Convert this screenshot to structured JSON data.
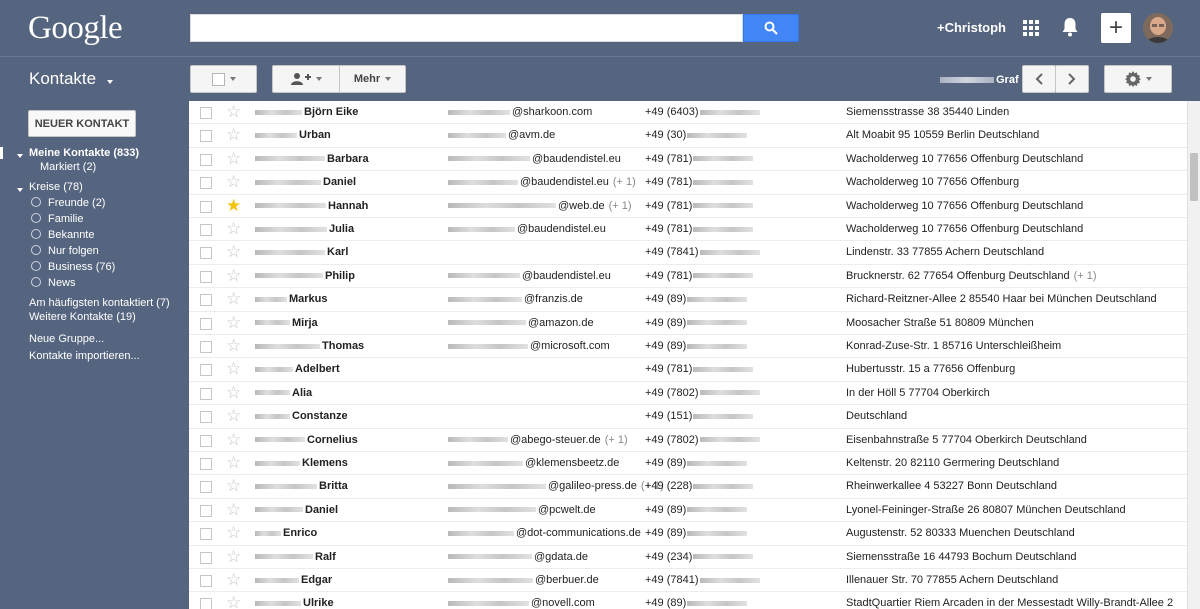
{
  "header": {
    "logo": "Google",
    "user": "+Christoph",
    "share_symbol": "+"
  },
  "toolbar": {
    "title": "Kontakte",
    "more_label": "Mehr",
    "account": "Graf"
  },
  "sidebar": {
    "new_contact": "NEUER KONTAKT",
    "my_contacts": "Meine Kontakte (833)",
    "starred": "Markiert (2)",
    "circles": "Kreise (78)",
    "circle_items": [
      "Freunde (2)",
      "Familie",
      "Bekannte",
      "Nur folgen",
      "Business (76)",
      "News"
    ],
    "most_contacted": "Am häufigsten kontaktiert (7)",
    "other_contacts": "Weitere Kontakte (19)",
    "new_group": "Neue Gruppe...",
    "import": "Kontakte importieren..."
  },
  "contacts": [
    {
      "name": "Björn Eike",
      "email": "@sharkoon.com",
      "email_extra": "",
      "phone": "+49 (6403)",
      "address": "Siemensstrasse 38 35440 Linden",
      "address_extra": "",
      "starred": false
    },
    {
      "name": "Urban",
      "email": "@avm.de",
      "email_extra": "",
      "phone": "+49 (30)",
      "address": "Alt Moabit 95 10559 Berlin Deutschland",
      "address_extra": "",
      "starred": false
    },
    {
      "name": "Barbara",
      "email": "@baudendistel.eu",
      "email_extra": "",
      "phone": "+49 (781)",
      "address": "Wacholderweg 10 77656 Offenburg Deutschland",
      "address_extra": "",
      "starred": false
    },
    {
      "name": "Daniel",
      "email": "@baudendistel.eu",
      "email_extra": "(+ 1)",
      "phone": "+49 (781)",
      "address": "Wacholderweg 10 77656 Offenburg",
      "address_extra": "",
      "starred": false
    },
    {
      "name": "Hannah",
      "email": "@web.de",
      "email_extra": "(+ 1)",
      "phone": "+49 (781)",
      "address": "Wacholderweg 10 77656 Offenburg Deutschland",
      "address_extra": "",
      "starred": true
    },
    {
      "name": "Julia",
      "email": "@baudendistel.eu",
      "email_extra": "",
      "phone": "+49 (781)",
      "address": "Wacholderweg 10 77656 Offenburg Deutschland",
      "address_extra": "",
      "starred": false
    },
    {
      "name": "Karl",
      "email": "",
      "email_extra": "",
      "phone": "+49 (7841)",
      "address": "Lindenstr. 33 77855 Achern Deutschland",
      "address_extra": "",
      "starred": false
    },
    {
      "name": "Philip",
      "email": "@baudendistel.eu",
      "email_extra": "",
      "phone": "+49 (781)",
      "address": "Brucknerstr. 62 77654 Offenburg Deutschland",
      "address_extra": "(+ 1)",
      "starred": false
    },
    {
      "name": "Markus",
      "email": "@franzis.de",
      "email_extra": "",
      "phone": "+49 (89)",
      "address": "Richard-Reitzner-Allee 2 85540 Haar bei München Deutschland",
      "address_extra": "",
      "starred": false
    },
    {
      "name": "Mirja",
      "email": "@amazon.de",
      "email_extra": "",
      "phone": "+49 (89)",
      "address": "Moosacher Straße 51 80809 München",
      "address_extra": "",
      "starred": false
    },
    {
      "name": "Thomas",
      "email": "@microsoft.com",
      "email_extra": "",
      "phone": "+49 (89)",
      "address": "Konrad-Zuse-Str. 1 85716 Unterschleißheim",
      "address_extra": "",
      "starred": false
    },
    {
      "name": "Adelbert",
      "email": "",
      "email_extra": "",
      "phone": "+49 (781)",
      "address": "Hubertusstr. 15 a 77656 Offenburg",
      "address_extra": "",
      "starred": false
    },
    {
      "name": "Alia",
      "email": "",
      "email_extra": "",
      "phone": "+49 (7802)",
      "address": "In der Höll 5 77704 Oberkirch",
      "address_extra": "",
      "starred": false
    },
    {
      "name": "Constanze",
      "email": "",
      "email_extra": "",
      "phone": "+49 (151)",
      "address": "Deutschland",
      "address_extra": "",
      "starred": false
    },
    {
      "name": "Cornelius",
      "email": "@abego-steuer.de",
      "email_extra": "(+ 1)",
      "phone": "+49 (7802)",
      "address": "Eisenbahnstraße 5 77704 Oberkirch Deutschland",
      "address_extra": "",
      "starred": false
    },
    {
      "name": "Klemens",
      "email": "@klemensbeetz.de",
      "email_extra": "",
      "phone": "+49 (89)",
      "address": "Keltenstr. 20 82110 Germering Deutschland",
      "address_extra": "",
      "starred": false
    },
    {
      "name": "Britta",
      "email": "@galileo-press.de",
      "email_extra": "(+ 1)",
      "phone": "+49 (228)",
      "address": "Rheinwerkallee 4 53227 Bonn Deutschland",
      "address_extra": "",
      "starred": false
    },
    {
      "name": "Daniel",
      "email": "@pcwelt.de",
      "email_extra": "",
      "phone": "+49 (89)",
      "address": "Lyonel-Feininger-Straße 26 80807 München Deutschland",
      "address_extra": "",
      "starred": false
    },
    {
      "name": "Enrico",
      "email": "@dot-communications.de",
      "email_extra": "",
      "phone": "+49 (89)",
      "address": "Augustenstr. 52 80333 Muenchen Deutschland",
      "address_extra": "",
      "starred": false
    },
    {
      "name": "Ralf",
      "email": "@gdata.de",
      "email_extra": "",
      "phone": "+49 (234)",
      "address": "Siemensstraße 16 44793 Bochum Deutschland",
      "address_extra": "",
      "starred": false
    },
    {
      "name": "Edgar",
      "email": "@berbuer.de",
      "email_extra": "",
      "phone": "+49 (7841)",
      "address": "Illenauer Str. 70 77855 Achern Deutschland",
      "address_extra": "",
      "starred": false
    },
    {
      "name": "Ulrike",
      "email": "@novell.com",
      "email_extra": "",
      "phone": "+49 (89)",
      "address": "StadtQuartier Riem Arcaden in der Messestadt Willy-Brandt-Allee 2",
      "address_extra": "",
      "starred": false
    }
  ]
}
